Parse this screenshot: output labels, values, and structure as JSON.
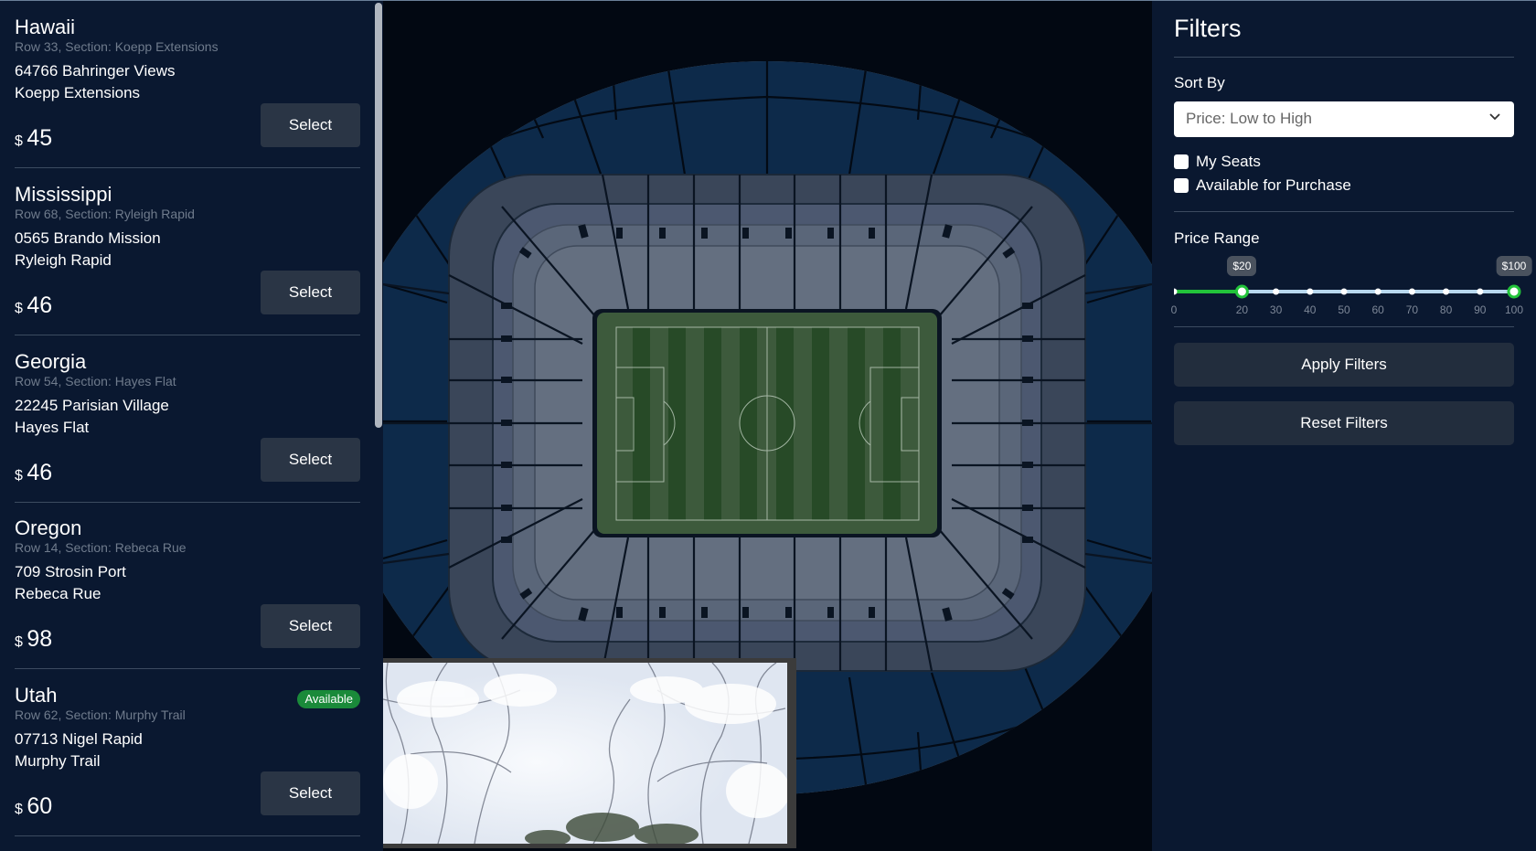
{
  "seats": [
    {
      "name": "Hawaii",
      "meta": "Row 33, Section: Koepp Extensions",
      "address": "64766 Bahringer Views",
      "area": "Koepp Extensions",
      "currency": "$",
      "price": "45",
      "select_label": "Select",
      "badge": ""
    },
    {
      "name": "Mississippi",
      "meta": "Row 68, Section: Ryleigh Rapid",
      "address": "0565 Brando Mission",
      "area": "Ryleigh Rapid",
      "currency": "$",
      "price": "46",
      "select_label": "Select",
      "badge": ""
    },
    {
      "name": "Georgia",
      "meta": "Row 54, Section: Hayes Flat",
      "address": "22245 Parisian Village",
      "area": "Hayes Flat",
      "currency": "$",
      "price": "46",
      "select_label": "Select",
      "badge": ""
    },
    {
      "name": "Oregon",
      "meta": "Row 14, Section: Rebeca Rue",
      "address": "709 Strosin Port",
      "area": "Rebeca Rue",
      "currency": "$",
      "price": "98",
      "select_label": "Select",
      "badge": ""
    },
    {
      "name": "Utah",
      "meta": "Row 62, Section: Murphy Trail",
      "address": "07713 Nigel Rapid",
      "area": "Murphy Trail",
      "currency": "$",
      "price": "60",
      "select_label": "Select",
      "badge": "Available"
    }
  ],
  "filters": {
    "title": "Filters",
    "sort_label": "Sort By",
    "sort_value": "Price: Low to High",
    "checkboxes": [
      {
        "label": "My Seats",
        "checked": false
      },
      {
        "label": "Available for Purchase",
        "checked": false
      }
    ],
    "price_label": "Price Range",
    "price_min": 20,
    "price_max": 100,
    "range_min": 0,
    "range_max": 100,
    "ticks": [
      "0",
      "20",
      "30",
      "40",
      "50",
      "60",
      "70",
      "80",
      "90",
      "100"
    ],
    "min_bubble": "$20",
    "max_bubble": "$100",
    "apply_label": "Apply Filters",
    "reset_label": "Reset Filters"
  },
  "colors": {
    "panel_bg": "#0a1830",
    "map_bg": "#020812",
    "accent_green": "#22c33a",
    "badge_green": "#1a8a3a",
    "pitch_green": "#2f4f2e",
    "slider_track": "#b8d8ee"
  }
}
